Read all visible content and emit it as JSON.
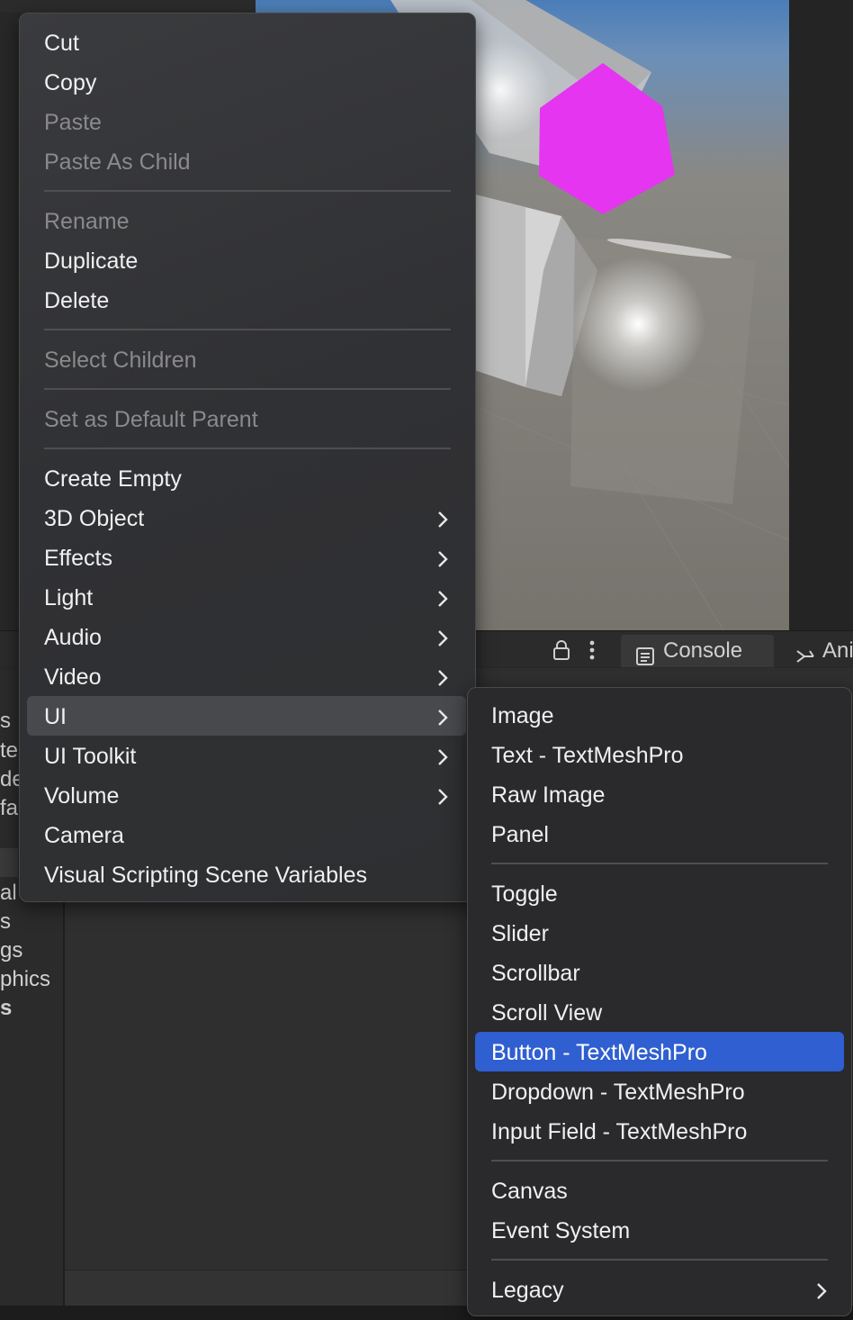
{
  "context_menu": {
    "items": [
      {
        "label": "Cut",
        "enabled": true
      },
      {
        "label": "Copy",
        "enabled": true
      },
      {
        "label": "Paste",
        "enabled": false
      },
      {
        "label": "Paste As Child",
        "enabled": false
      },
      {
        "label": "Rename",
        "enabled": false
      },
      {
        "label": "Duplicate",
        "enabled": true
      },
      {
        "label": "Delete",
        "enabled": true
      },
      {
        "label": "Select Children",
        "enabled": false
      },
      {
        "label": "Set as Default Parent",
        "enabled": false
      },
      {
        "label": "Create Empty",
        "enabled": true
      },
      {
        "label": "3D Object",
        "enabled": true,
        "submenu": true
      },
      {
        "label": "Effects",
        "enabled": true,
        "submenu": true
      },
      {
        "label": "Light",
        "enabled": true,
        "submenu": true
      },
      {
        "label": "Audio",
        "enabled": true,
        "submenu": true
      },
      {
        "label": "Video",
        "enabled": true,
        "submenu": true
      },
      {
        "label": "UI",
        "enabled": true,
        "submenu": true,
        "open": true
      },
      {
        "label": "UI Toolkit",
        "enabled": true,
        "submenu": true
      },
      {
        "label": "Volume",
        "enabled": true,
        "submenu": true
      },
      {
        "label": "Camera",
        "enabled": true
      },
      {
        "label": "Visual Scripting Scene Variables",
        "enabled": true
      }
    ]
  },
  "ui_submenu": {
    "items": [
      {
        "label": "Image"
      },
      {
        "label": "Text - TextMeshPro"
      },
      {
        "label": "Raw Image"
      },
      {
        "label": "Panel"
      },
      {
        "label": "Toggle"
      },
      {
        "label": "Slider"
      },
      {
        "label": "Scrollbar"
      },
      {
        "label": "Scroll View"
      },
      {
        "label": "Button - TextMeshPro",
        "highlighted": true
      },
      {
        "label": "Dropdown - TextMeshPro"
      },
      {
        "label": "Input Field - TextMeshPro"
      },
      {
        "label": "Canvas"
      },
      {
        "label": "Event System"
      },
      {
        "label": "Legacy",
        "submenu": true
      }
    ]
  },
  "tabs": {
    "console": "Console",
    "animation_partial": "Ani"
  },
  "toolbar_icons": [
    "lock-icon",
    "kebab-menu-icon"
  ],
  "left_panel_fragments": [
    "s",
    "ter",
    "de",
    "fa",
    "al",
    "s",
    "gs",
    "phics",
    "s"
  ],
  "colors": {
    "menu_bg": "#2f2f31",
    "highlight": "#2f5fd0",
    "open_submenu_bg": "#48494d",
    "magenta_hexagon": "#e535f0"
  }
}
